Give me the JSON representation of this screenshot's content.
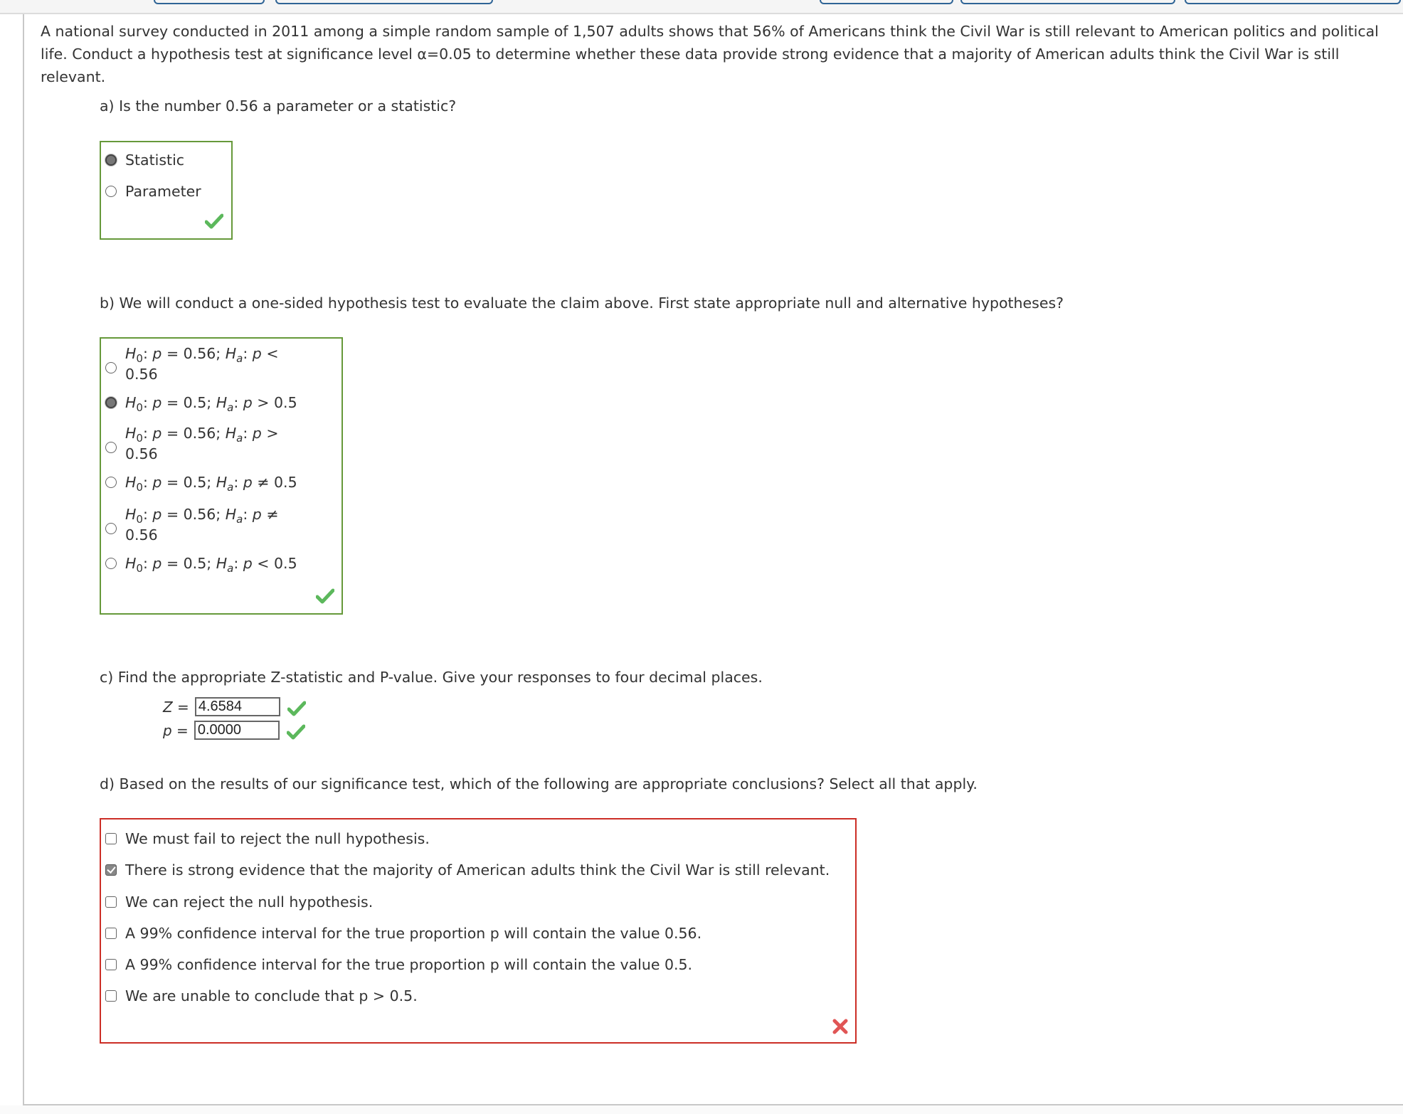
{
  "problem": {
    "intro": "A national survey conducted in 2011 among a simple random sample of 1,507 adults shows that 56% of Americans think the Civil War is still relevant to American politics and political life. Conduct a hypothesis test at significance level α=0.05 to determine whether these data provide strong evidence that a majority of American adults think the Civil War is still relevant."
  },
  "part_a": {
    "question": "a) Is the number 0.56 a parameter or a statistic?",
    "options": [
      {
        "label": "Statistic",
        "selected": true
      },
      {
        "label": "Parameter",
        "selected": false
      }
    ],
    "status": "correct",
    "status_icon": "check-icon"
  },
  "part_b": {
    "question": "b) We will conduct a one-sided hypothesis test to evaluate the claim above. First state appropriate null and alternative hypotheses?",
    "options": [
      {
        "h0": "0.56",
        "op": "<",
        "ha": "0.56",
        "selected": false
      },
      {
        "h0": "0.5",
        "op": ">",
        "ha": "0.5",
        "selected": true
      },
      {
        "h0": "0.56",
        "op": ">",
        "ha": "0.56",
        "selected": false
      },
      {
        "h0": "0.5",
        "op": "≠",
        "ha": "0.5",
        "selected": false
      },
      {
        "h0": "0.56",
        "op": "≠",
        "ha": "0.56",
        "selected": false
      },
      {
        "h0": "0.5",
        "op": "<",
        "ha": "0.5",
        "selected": false
      }
    ],
    "status": "correct",
    "status_icon": "check-icon"
  },
  "part_c": {
    "question": "c) Find the appropriate Z-statistic and P-value. Give your responses to four decimal places.",
    "z_label": "Z =",
    "z_value": "4.6584",
    "p_label": "p =",
    "p_value": "0.0000",
    "status": "correct"
  },
  "part_d": {
    "question": "d) Based on the results of our significance test, which of the following are appropriate conclusions? Select all that apply.",
    "options": [
      {
        "label": "We must fail to reject the null hypothesis.",
        "checked": false
      },
      {
        "label": "There is strong evidence that the majority of American adults think the Civil War is still relevant.",
        "checked": true
      },
      {
        "label": "We can reject the null hypothesis.",
        "checked": false
      },
      {
        "label": "A 99% confidence interval for the true proportion p will contain the value 0.56.",
        "checked": false
      },
      {
        "label": "A 99% confidence interval for the true proportion p will contain the value 0.5.",
        "checked": false
      },
      {
        "label": "We are unable to conclude that p > 0.5.",
        "checked": false
      }
    ],
    "status": "incorrect",
    "status_icon": "x-icon"
  },
  "colors": {
    "correct_border": "#66993a",
    "incorrect_border": "#cc2e26",
    "check_green": "#5cb85c",
    "x_red": "#e05555",
    "tab_blue": "#2f6496"
  }
}
